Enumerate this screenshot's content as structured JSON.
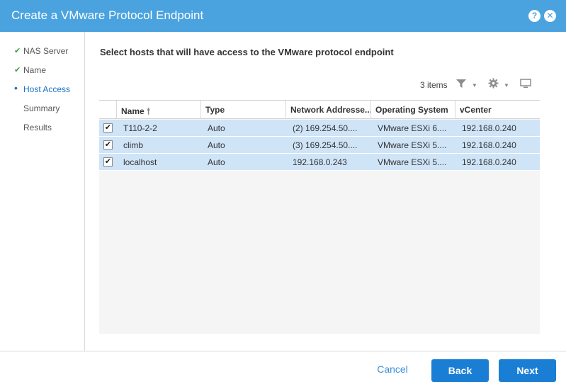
{
  "dialog": {
    "title": "Create a VMware Protocol Endpoint",
    "help_glyph": "?",
    "close_glyph": "✕"
  },
  "steps": [
    {
      "label": "NAS Server",
      "state": "done",
      "mark": "✔"
    },
    {
      "label": "Name",
      "state": "done",
      "mark": "✔"
    },
    {
      "label": "Host Access",
      "state": "active",
      "mark": "•"
    },
    {
      "label": "Summary",
      "state": "pending",
      "mark": ""
    },
    {
      "label": "Results",
      "state": "pending",
      "mark": ""
    }
  ],
  "main": {
    "heading": "Select hosts that will have access to the VMware protocol endpoint",
    "item_count": "3 items"
  },
  "icons": {
    "filter": "filter-icon",
    "gear": "gear-icon",
    "monitor": "monitor-icon",
    "sort": "arrow-up-icon"
  },
  "table": {
    "columns": [
      "Name",
      "Type",
      "Network Addresse...",
      "Operating System",
      "vCenter"
    ],
    "sort_indicator": "🠕",
    "rows": [
      {
        "checked": "✔",
        "name": "T110-2-2",
        "type": "Auto",
        "address": "(2) 169.254.50....",
        "os": "VMware ESXi 6....",
        "vcenter": "192.168.0.240"
      },
      {
        "checked": "✔",
        "name": "climb",
        "type": "Auto",
        "address": "(3) 169.254.50....",
        "os": "VMware ESXi 5....",
        "vcenter": "192.168.0.240"
      },
      {
        "checked": "✔",
        "name": "localhost",
        "type": "Auto",
        "address": "192.168.0.243",
        "os": "VMware ESXi 5....",
        "vcenter": "192.168.0.240"
      }
    ]
  },
  "footer": {
    "cancel": "Cancel",
    "back": "Back",
    "next": "Next"
  },
  "colors": {
    "titlebar": "#4aa3df",
    "selected_row": "#cfe4f7",
    "primary_button": "#1a7fd4",
    "active_step": "#1a73c7",
    "done_check": "#3c9a3c"
  }
}
